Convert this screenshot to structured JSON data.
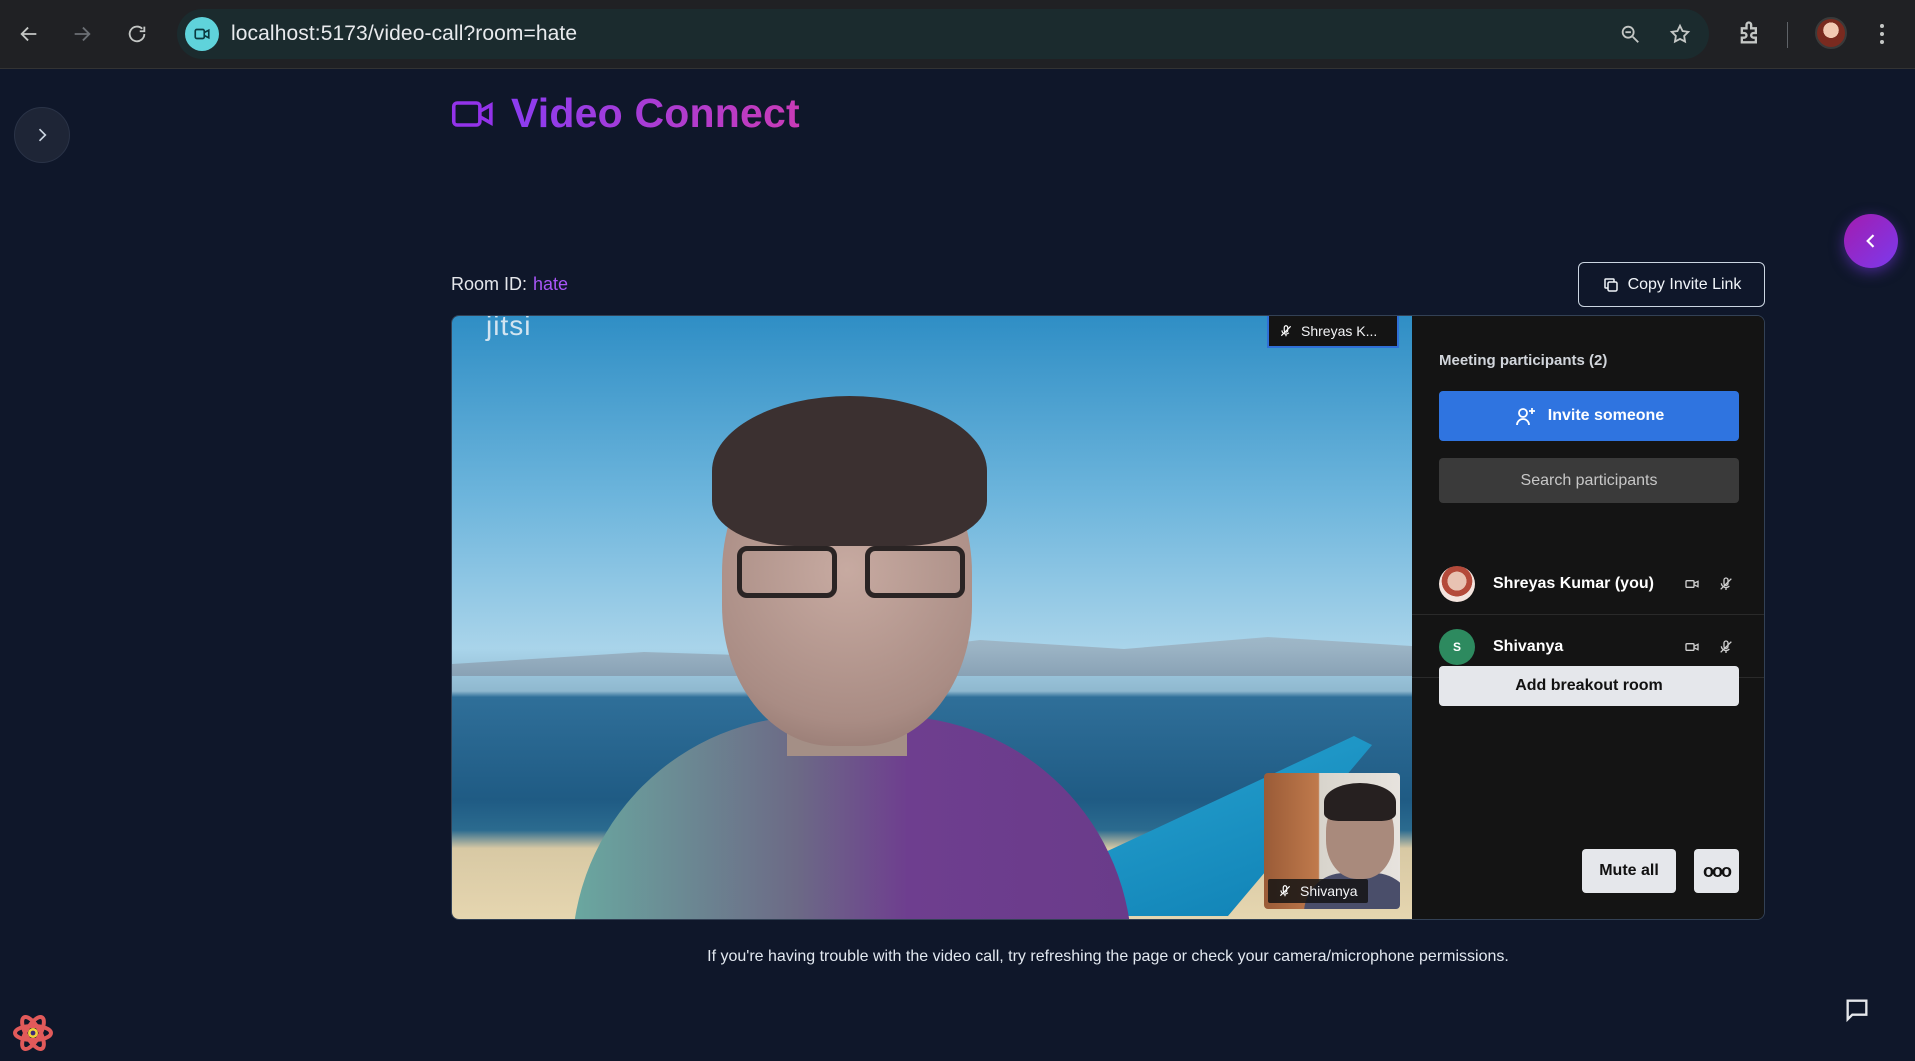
{
  "browser": {
    "url": "localhost:5173/video-call?room=hate",
    "back_icon": "arrow-left-icon",
    "forward_icon": "arrow-right-icon",
    "reload_icon": "reload-icon"
  },
  "header": {
    "title": "Video Connect",
    "icon": "video-camera-icon",
    "accent_color": "#9333ea"
  },
  "room": {
    "label": "Room ID:",
    "value": "hate"
  },
  "copy_invite": {
    "label": "Copy Invite Link"
  },
  "call": {
    "watermark": "jitsi",
    "main_speaker_tag": "Shreyas K...",
    "pip_name": "Shivanya",
    "panel": {
      "title": "Meeting participants (2)",
      "invite_label": "Invite someone",
      "search_placeholder": "Search participants",
      "participants": [
        {
          "name": "Shreyas Kumar (you)",
          "initial": ""
        },
        {
          "name": "Shivanya",
          "initial": "S",
          "avatar_color": "#2d8a5f"
        }
      ],
      "breakout_label": "Add breakout room",
      "mute_all_label": "Mute all",
      "more_label": "ooo"
    }
  },
  "footer": {
    "help_text": "If you're having trouble with the video call, try refreshing the page or check your camera/microphone permissions."
  }
}
